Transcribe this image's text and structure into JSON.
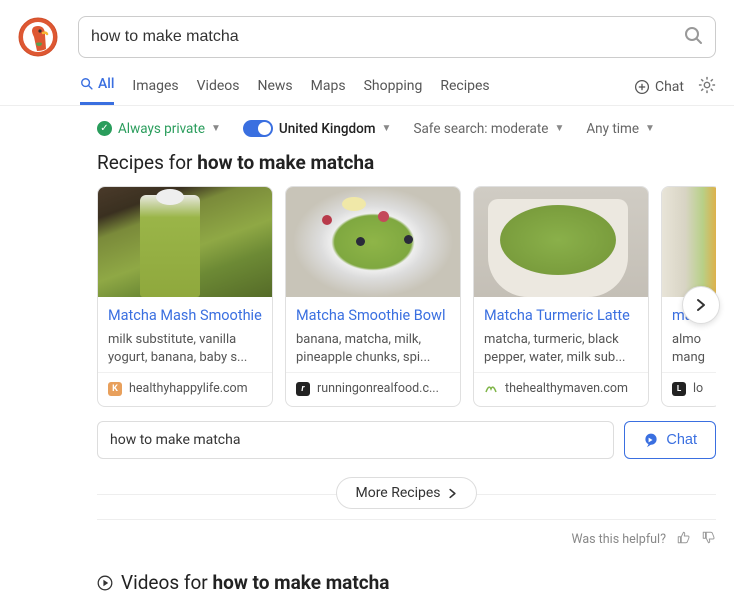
{
  "search": {
    "query": "how to make matcha"
  },
  "tabs": {
    "all": "All",
    "images": "Images",
    "videos": "Videos",
    "news": "News",
    "maps": "Maps",
    "shopping": "Shopping",
    "recipes": "Recipes",
    "chat": "Chat"
  },
  "filters": {
    "private": "Always private",
    "region": "United Kingdom",
    "safesearch": "Safe search: moderate",
    "time": "Any time"
  },
  "recipes": {
    "heading_prefix": "Recipes for ",
    "heading_bold": "how to make matcha",
    "cards": [
      {
        "title": "Matcha Mash Smoothie",
        "desc": "milk substitute, vanilla yogurt, banana, baby s...",
        "source": "healthyhappylife.com"
      },
      {
        "title": "Matcha Smoothie Bowl",
        "desc": "banana, matcha, milk, pineapple chunks, spi...",
        "source": "runningonrealfood.c..."
      },
      {
        "title": "Matcha Turmeric Latte",
        "desc": "matcha, turmeric, black pepper, water, milk sub...",
        "source": "thehealthymaven.com"
      },
      {
        "title": "matc",
        "desc": "almo\nmang",
        "source": "lo"
      }
    ],
    "more": "More Recipes"
  },
  "assist": {
    "prompt": "how to make matcha",
    "chat": "Chat"
  },
  "feedback": {
    "label": "Was this helpful?"
  },
  "videos": {
    "heading_prefix": "Videos for ",
    "heading_bold": "how to make matcha"
  }
}
